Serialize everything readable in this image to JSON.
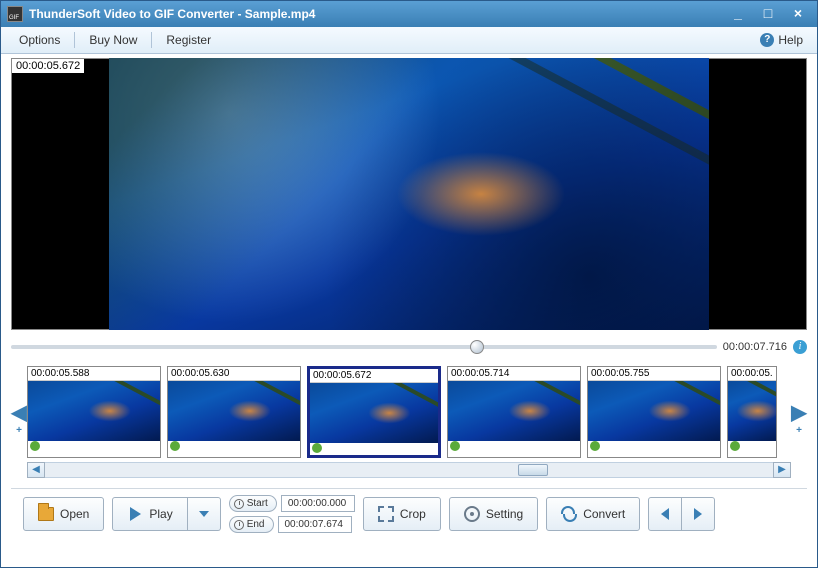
{
  "window": {
    "title": "ThunderSoft Video to GIF Converter - Sample.mp4"
  },
  "menu": {
    "options": "Options",
    "buynow": "Buy Now",
    "register": "Register",
    "help": "Help"
  },
  "preview": {
    "current_timestamp": "00:00:05.672",
    "duration": "00:00:07.716",
    "slider_position_pct": 65
  },
  "thumbnails": [
    {
      "ts": "00:00:05.588",
      "selected": false
    },
    {
      "ts": "00:00:05.630",
      "selected": false
    },
    {
      "ts": "00:00:05.672",
      "selected": true
    },
    {
      "ts": "00:00:05.714",
      "selected": false
    },
    {
      "ts": "00:00:05.755",
      "selected": false
    },
    {
      "ts": "00:00:05.",
      "selected": false,
      "partial": true
    }
  ],
  "hscroll": {
    "thumb_left_pct": 65
  },
  "time": {
    "start_label": "Start",
    "end_label": "End",
    "start_value": "00:00:00.000",
    "end_value": "00:00:07.674"
  },
  "buttons": {
    "open": "Open",
    "play": "Play",
    "crop": "Crop",
    "setting": "Setting",
    "convert": "Convert"
  }
}
